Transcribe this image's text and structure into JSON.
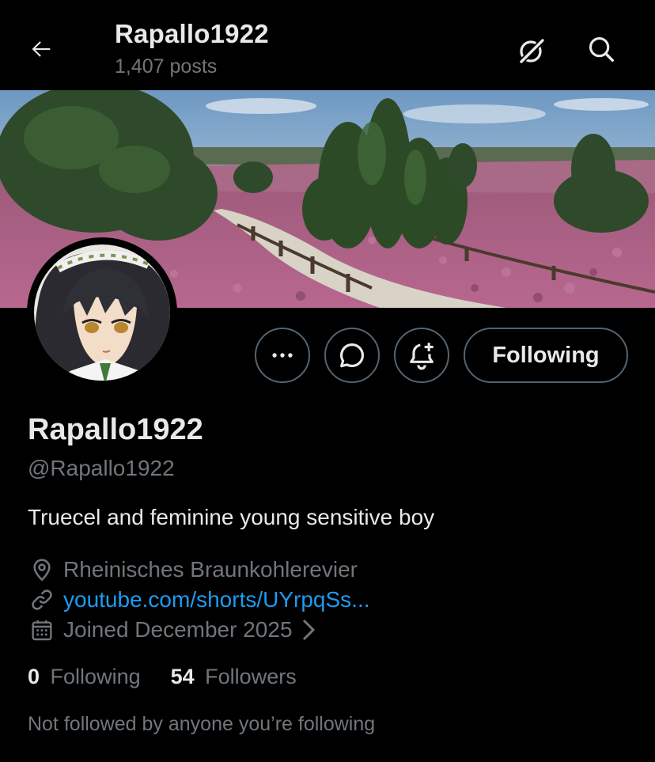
{
  "header": {
    "title": "Rapallo1922",
    "posts_count": "1,407 posts"
  },
  "profile": {
    "display_name": "Rapallo1922",
    "handle": "@Rapallo1922",
    "bio": "Truecel and feminine young sensitive boy",
    "location": "Rheinisches Braunkohlerevier",
    "website": "youtube.com/shorts/UYrpqSs...",
    "joined": "Joined December 2025",
    "following_count": "0",
    "following_label": "Following",
    "followers_count": "54",
    "followers_label": "Followers",
    "followed_by": "Not followed by anyone you’re following"
  },
  "actions": {
    "following_button": "Following"
  },
  "colors": {
    "background": "#000000",
    "text_primary": "#e7e9ea",
    "text_secondary": "#71767b",
    "link": "#1d9bf0",
    "button_border": "#536471"
  },
  "icons": [
    "back-arrow-icon",
    "grok-icon",
    "search-icon",
    "more-icon",
    "message-icon",
    "notification-add-icon",
    "location-icon",
    "link-icon",
    "calendar-icon",
    "chevron-right-icon"
  ]
}
